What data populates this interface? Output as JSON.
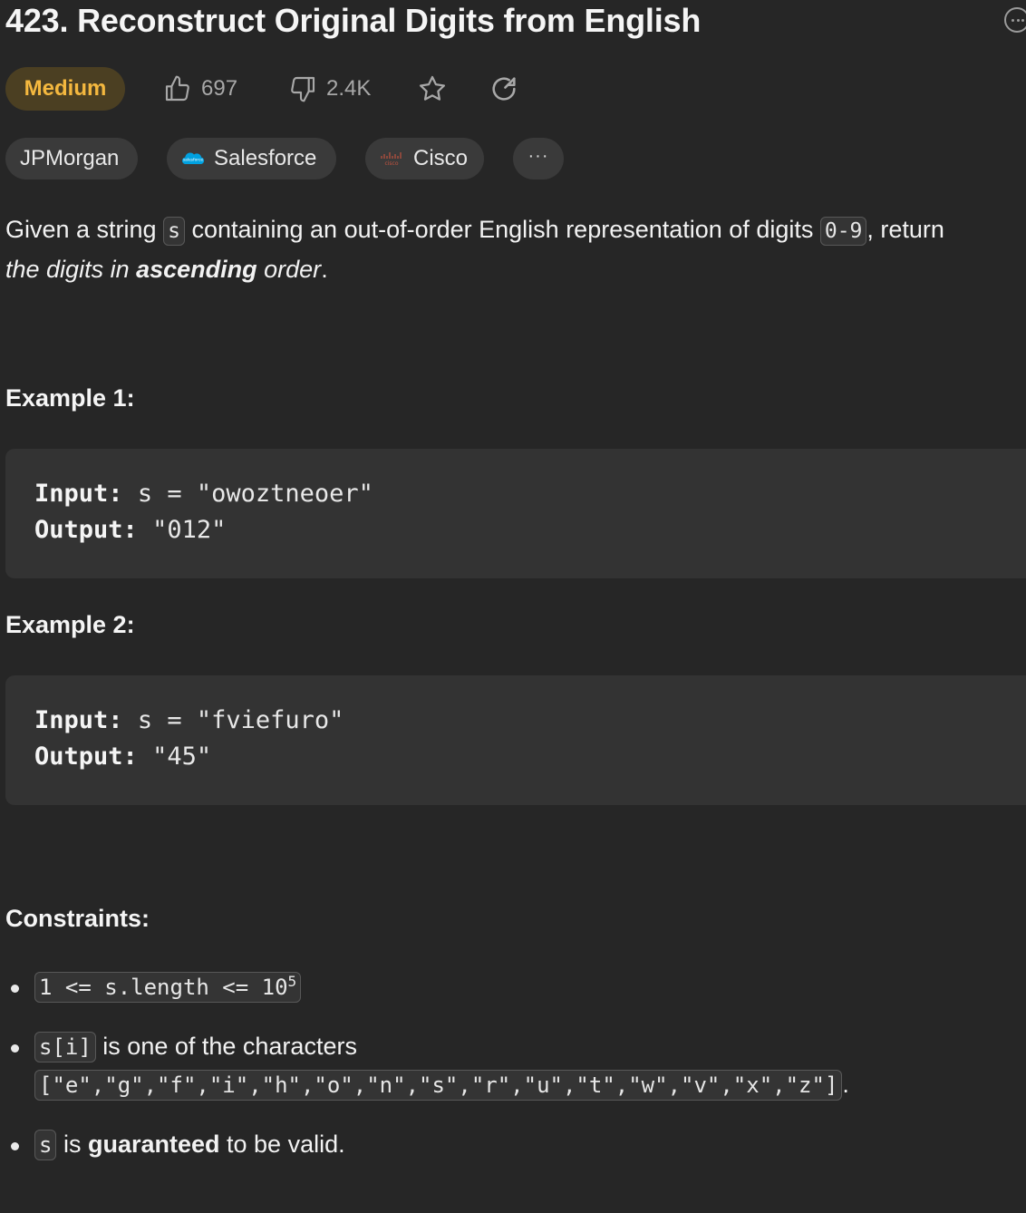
{
  "problem": {
    "title": "423. Reconstruct Original Digits from English",
    "difficulty": "Medium",
    "likes": "697",
    "dislikes": "2.4K"
  },
  "companies": [
    "JPMorgan",
    "Salesforce",
    "Cisco"
  ],
  "company_logo_text": {
    "salesforce": "salesforce",
    "cisco": "cisco"
  },
  "more_tags": "···",
  "description": {
    "part1": "Given a string ",
    "code1": "s",
    "part2": " containing an out-of-order English representation of digits ",
    "code2": "0-9",
    "part3": ", return",
    "part4": "the digits in ",
    "bold": "ascending",
    "part5": " order",
    "period": "."
  },
  "examples": [
    {
      "heading": "Example 1:",
      "input_label": "Input:",
      "input": "s = \"owoztneoer\"",
      "output_label": "Output:",
      "output": "\"012\""
    },
    {
      "heading": "Example 2:",
      "input_label": "Input:",
      "input": "s = \"fviefuro\"",
      "output_label": "Output:",
      "output": "\"45\""
    }
  ],
  "constraints": {
    "heading": "Constraints:",
    "c1_code": "1 <= s.length <= 10",
    "c1_exp": "5",
    "c2_code": "s[i]",
    "c2_text": " is one of the characters",
    "c2_chars": "[\"e\",\"g\",\"f\",\"i\",\"h\",\"o\",\"n\",\"s\",\"r\",\"u\",\"t\",\"w\",\"v\",\"x\",\"z\"]",
    "c2_period": ".",
    "c3_code": "s",
    "c3_text1": " is ",
    "c3_bold": "guaranteed",
    "c3_text2": " to be valid."
  },
  "icons": {
    "like": "thumbs-up-icon",
    "dislike": "thumbs-down-icon",
    "favorite": "star-icon",
    "share": "share-icon",
    "more": "more-options-icon"
  },
  "colors": {
    "background": "#262626",
    "difficulty_text": "#f4b83f",
    "difficulty_bg": "#4b3f22",
    "chip_bg": "#3a3a3a",
    "code_block_bg": "#333333"
  }
}
